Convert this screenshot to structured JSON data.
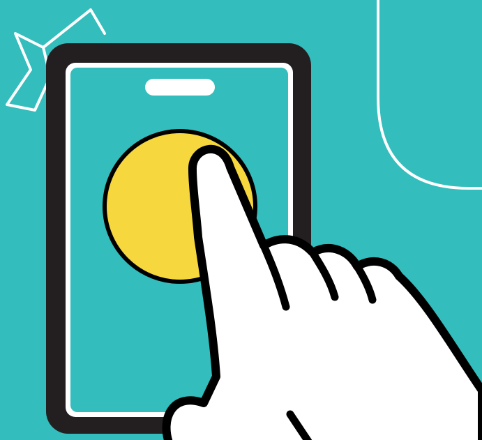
{
  "colors": {
    "background": "#33BDBC",
    "phone_body": "#231F20",
    "phone_screen": "#33BDBC",
    "screen_border": "#FFFFFF",
    "speaker": "#FFFFFF",
    "button": "#F7D73E",
    "hand_fill": "#FFFFFF",
    "outline": "#000000"
  },
  "icons": {
    "phone": "smartphone-icon",
    "tap_target": "circle-button-icon",
    "hand": "pointing-hand-icon",
    "burst": "sparkle-burst-icon",
    "corner_shape": "rounded-corner-decoration"
  }
}
